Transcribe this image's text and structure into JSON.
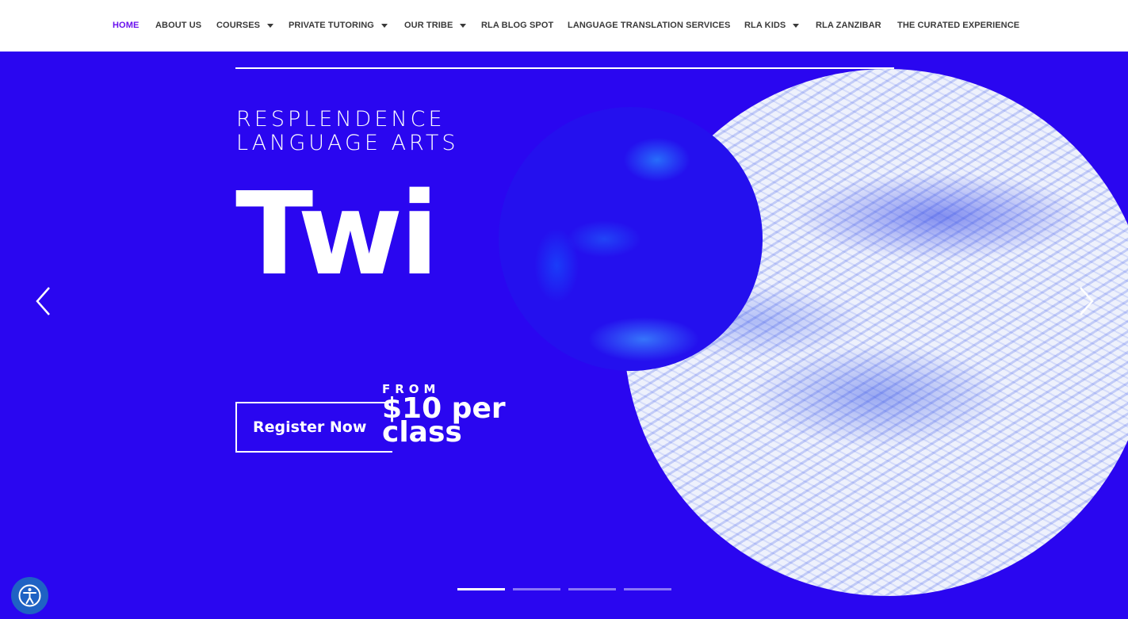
{
  "nav": {
    "items": [
      {
        "label": "HOME",
        "dropdown": false,
        "active": true
      },
      {
        "label": "ABOUT US",
        "dropdown": false,
        "active": false
      },
      {
        "label": "COURSES",
        "dropdown": true,
        "active": false
      },
      {
        "label": "PRIVATE TUTORING",
        "dropdown": true,
        "active": false
      },
      {
        "label": "OUR TRIBE",
        "dropdown": true,
        "active": false
      },
      {
        "label": "RLA BLOG SPOT",
        "dropdown": false,
        "active": false
      },
      {
        "label": "LANGUAGE TRANSLATION SERVICES",
        "dropdown": false,
        "active": false
      },
      {
        "label": "RLA KIDS",
        "dropdown": true,
        "active": false
      },
      {
        "label": "RLA ZANZIBAR",
        "dropdown": false,
        "active": false
      },
      {
        "label": "THE CURATED EXPERIENCE",
        "dropdown": false,
        "active": false
      }
    ]
  },
  "hero": {
    "brand_line1": "RESPLENDENCE",
    "brand_line2": "LANGUAGE ARTS",
    "course_name": "Twi",
    "cta_label": "Register Now",
    "price_prefix": "FROM",
    "price": "$10 per class",
    "slide_count": 4,
    "active_slide": 1
  },
  "icons": {
    "prev": "chevron-left-icon",
    "next": "chevron-right-icon",
    "accessibility": "accessibility-icon"
  },
  "colors": {
    "hero_background": "#2a06f0",
    "nav_active": "#6a11ee",
    "nav_text": "#3a3a3a",
    "accessibility_button": "#1f62c4"
  }
}
